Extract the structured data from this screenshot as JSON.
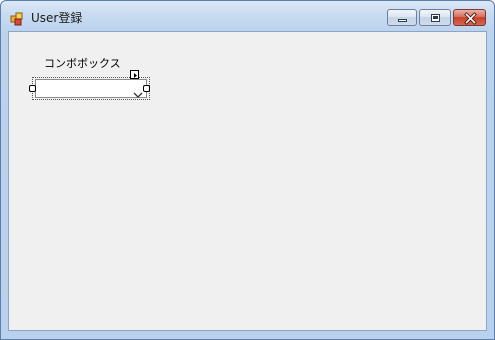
{
  "window": {
    "title": "User登録",
    "caption_buttons": [
      {
        "name": "minimize",
        "icon": "minimize-icon"
      },
      {
        "name": "maximize",
        "icon": "maximize-icon"
      },
      {
        "name": "close",
        "icon": "close-icon"
      }
    ]
  },
  "form": {
    "combo_label": "コンボボックス",
    "combo": {
      "value": "",
      "arrow_icon": "chevron-down-icon"
    },
    "designer": {
      "smart_tag_icon": "smart-tag-arrow-icon",
      "selected": true
    }
  },
  "colors": {
    "client_background": "#f0f0f0",
    "close_button": "#c8412b",
    "titlebar": "#c8dbf1"
  }
}
